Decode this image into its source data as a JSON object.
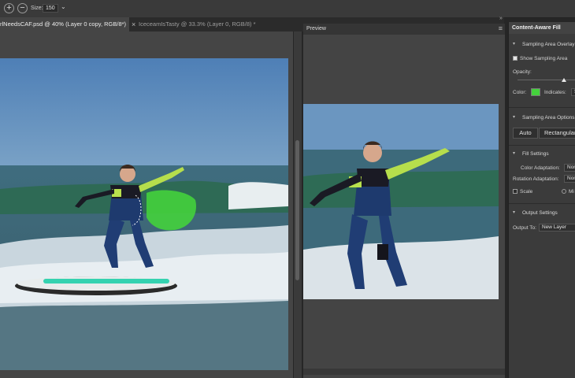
{
  "options_bar": {
    "zoom_in_symbol": "+",
    "zoom_out_symbol": "−",
    "size_label": "Size:",
    "size_value": "150",
    "dropdown_symbol": "⌄"
  },
  "tabs": [
    {
      "label": "rlNeedsCAF.psd @ 40% (Layer 0 copy, RGB/8*)",
      "active": true
    },
    {
      "label": "IceceamIsTasty @ 33.3% (Layer 0, RGB/8) *",
      "active": false
    }
  ],
  "tab_close_symbol": "×",
  "preview": {
    "title": "Preview",
    "menu_symbol": "≡"
  },
  "panel": {
    "collapse_symbol": "»",
    "title": "Content-Aware Fill",
    "sampling_overlay": {
      "title": "Sampling Area Overlay",
      "show_label": "Show Sampling Area",
      "show_checked": true,
      "opacity_label": "Opacity:",
      "opacity_value": 0.6,
      "color_label": "Color:",
      "color": "#44d13c",
      "indicates_label": "Indicates:",
      "indicates_value": "S"
    },
    "sampling_options": {
      "title": "Sampling Area Options",
      "auto_label": "Auto",
      "rect_label": "Rectangular"
    },
    "fill_settings": {
      "title": "Fill Settings",
      "color_adaptation_label": "Color Adaptation:",
      "color_adaptation_value": "Nor",
      "rotation_adaptation_label": "Rotation Adaptation:",
      "rotation_adaptation_value": "Non",
      "scale_label": "Scale",
      "mirror_label": "Mi"
    },
    "output_settings": {
      "title": "Output Settings",
      "output_to_label": "Output To:",
      "output_to_value": "New Layer"
    }
  },
  "colors": {
    "sampling_overlay": "#44d13c",
    "sky": "#5c87b8",
    "sea": "#3e6876",
    "wetsuit": "#1e3f78",
    "lime": "#b6de4c"
  }
}
